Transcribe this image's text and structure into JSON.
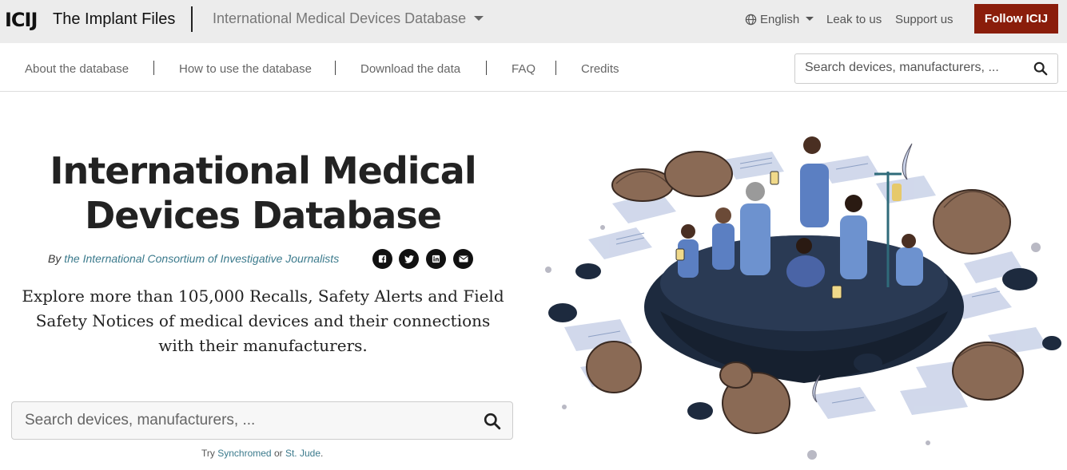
{
  "header": {
    "logo": "ICIJ",
    "brand": "The Implant Files",
    "database_title": "International Medical Devices Database",
    "language": "English",
    "leak": "Leak to us",
    "support": "Support us",
    "follow": "Follow ICIJ"
  },
  "subnav": {
    "items": [
      "About the database",
      "How to use the database",
      "Download the data",
      "FAQ",
      "Credits"
    ],
    "search_placeholder": "Search devices, manufacturers, ..."
  },
  "hero": {
    "title_line1": "International Medical",
    "title_line2": "Devices Database",
    "by_prefix": "By",
    "by_link": "the International Consortium of Investigative Journalists",
    "intro": "Explore more than 105,000 Recalls, Safety Alerts and Field Safety Notices of medical devices and their connections with their manufacturers.",
    "search_placeholder": "Search devices, manufacturers, ...",
    "try_prefix": "Try",
    "try_link1": "Synchromed",
    "try_or": "or",
    "try_link2": "St. Jude",
    "try_suffix": "."
  },
  "social_icons": [
    "facebook-icon",
    "twitter-icon",
    "linkedin-icon",
    "email-icon"
  ],
  "colors": {
    "topbar_bg": "#ececec",
    "follow_button": "#8a1d0b",
    "link": "#3b7a8c",
    "illustration_dark": "#1d2a3e"
  }
}
